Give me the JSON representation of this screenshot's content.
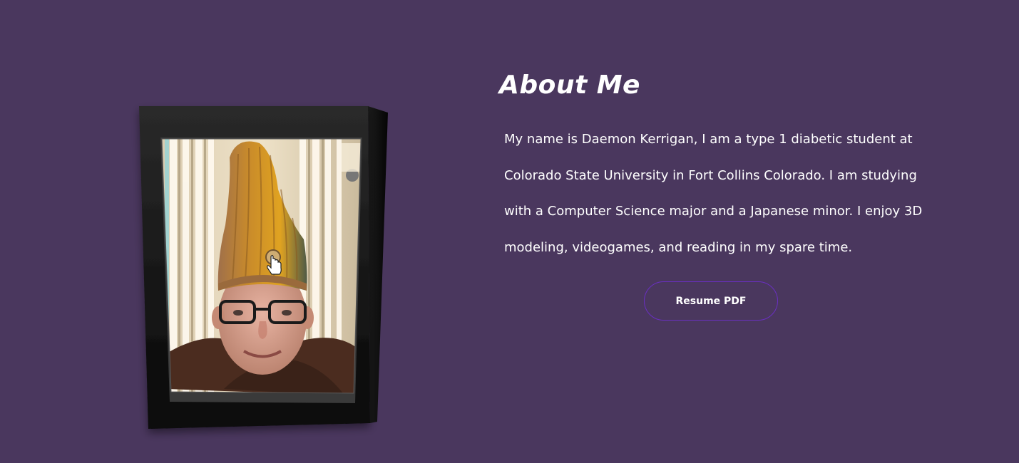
{
  "about": {
    "title": "About Me",
    "paragraph": "My name is Daemon Kerrigan, I am a type 1 diabetic student at Colorado State University in Fort Collins Colorado. I am studying with a Computer Science major and a Japanese minor. I enjoy 3D modeling, videogames, and reading in my spare time.",
    "resume_button_label": "Resume PDF"
  },
  "photo": {
    "icon": "portrait-photo",
    "cursor_icon": "pointer-hand-icon"
  },
  "colors": {
    "background": "#4a375e",
    "button_border": "#6a2fc2",
    "text": "#ffffff",
    "frame": "#101010"
  }
}
